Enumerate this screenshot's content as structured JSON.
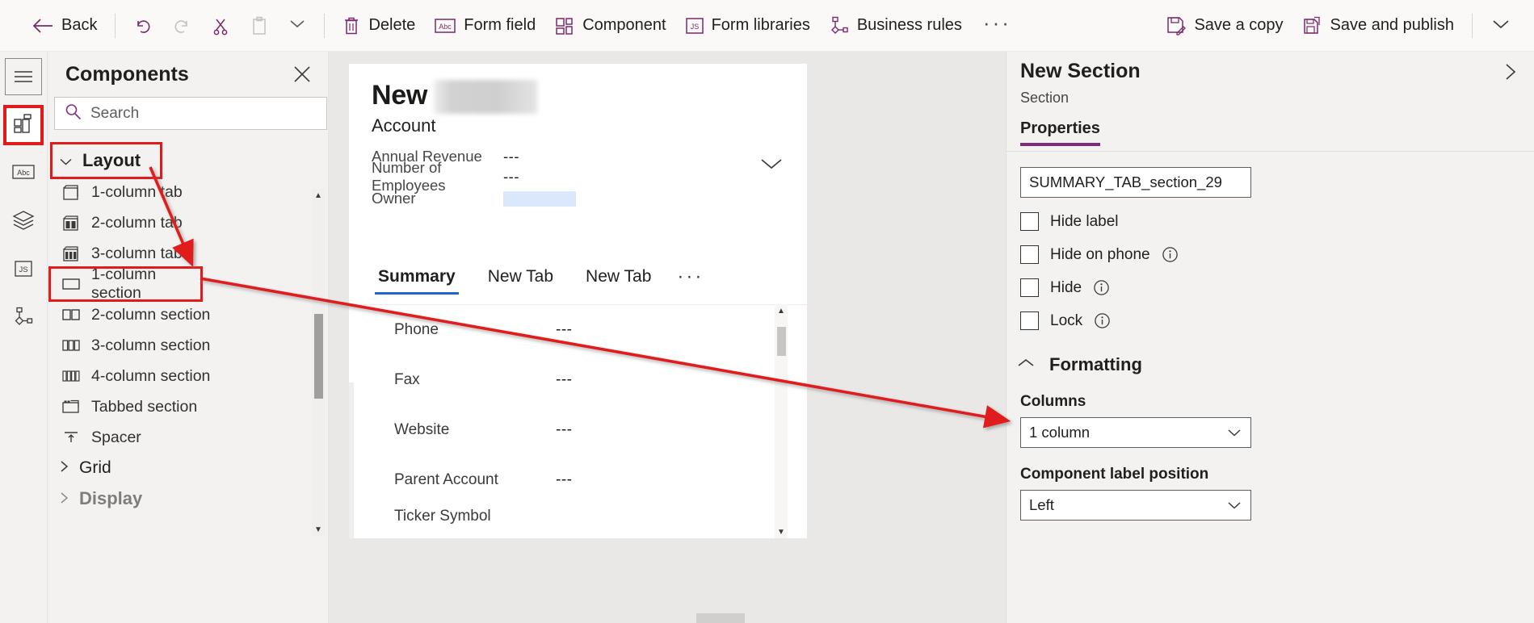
{
  "commandbar": {
    "back_label": "Back",
    "undo_icon": "undo-icon",
    "redo_icon": "redo-icon",
    "cut_icon": "cut-icon",
    "paste_icon": "paste-icon",
    "more_chevron_icon": "chevron-down-icon",
    "delete_label": "Delete",
    "form_field_label": "Form field",
    "component_label": "Component",
    "form_libraries_label": "Form libraries",
    "business_rules_label": "Business rules",
    "overflow_label": "···",
    "save_a_copy_label": "Save a copy",
    "save_and_publish_label": "Save and publish",
    "publish_chevron_icon": "chevron-down-icon"
  },
  "rail": {
    "items": [
      {
        "name": "menu-icon",
        "label": "Menu"
      },
      {
        "name": "components-icon",
        "label": "Components"
      },
      {
        "name": "table-columns-icon",
        "label": "Table columns"
      },
      {
        "name": "layers-icon",
        "label": "Tree view"
      },
      {
        "name": "js-icon",
        "label": "Form libraries"
      },
      {
        "name": "business-rules-icon",
        "label": "Business rules"
      }
    ]
  },
  "components_panel": {
    "title": "Components",
    "close_icon": "close-icon",
    "search": {
      "placeholder": "Search",
      "value": "",
      "icon": "search-icon"
    },
    "groups": [
      {
        "label": "Layout",
        "expanded": true,
        "highlighted": true,
        "items": [
          {
            "label": "1-column tab",
            "icon": "one-column-tab-icon",
            "highlighted": false
          },
          {
            "label": "2-column tab",
            "icon": "two-column-tab-icon",
            "highlighted": false
          },
          {
            "label": "3-column tab",
            "icon": "three-column-tab-icon",
            "highlighted": false
          },
          {
            "label": "1-column section",
            "icon": "one-column-section-icon",
            "highlighted": true
          },
          {
            "label": "2-column section",
            "icon": "two-column-section-icon",
            "highlighted": false
          },
          {
            "label": "3-column section",
            "icon": "three-column-section-icon",
            "highlighted": false
          },
          {
            "label": "4-column section",
            "icon": "four-column-section-icon",
            "highlighted": false
          },
          {
            "label": "Tabbed section",
            "icon": "tabbed-section-icon",
            "highlighted": false
          },
          {
            "label": "Spacer",
            "icon": "spacer-icon",
            "highlighted": false
          }
        ]
      },
      {
        "label": "Grid",
        "expanded": false,
        "highlighted": false,
        "items": []
      },
      {
        "label": "Display",
        "expanded": false,
        "highlighted": false,
        "items": []
      }
    ]
  },
  "canvas": {
    "form_header": {
      "title": "New",
      "redacted_name": "",
      "subtitle": "Account",
      "expand_icon": "chevron-down-icon",
      "fields": [
        {
          "label": "Annual Revenue",
          "value": "---",
          "filled": false
        },
        {
          "label": "Number of Employees",
          "value": "---",
          "filled": false
        },
        {
          "label": "Owner",
          "value": "",
          "filled": true
        }
      ]
    },
    "tabs": [
      {
        "label": "Summary",
        "active": true
      },
      {
        "label": "New Tab",
        "active": false
      },
      {
        "label": "New Tab",
        "active": false
      }
    ],
    "tabs_overflow": "···",
    "fields": [
      {
        "label": "Phone",
        "value": "---"
      },
      {
        "label": "Fax",
        "value": "---"
      },
      {
        "label": "Website",
        "value": "---"
      },
      {
        "label": "Parent Account",
        "value": "---"
      },
      {
        "label": "Ticker Symbol",
        "value": ""
      }
    ]
  },
  "properties": {
    "title": "New Section",
    "subtitle": "Section",
    "collapse_icon": "chevron-right-icon",
    "tabs": [
      {
        "label": "Properties",
        "active": true
      }
    ],
    "name_field": {
      "value": "SUMMARY_TAB_section_29"
    },
    "checkboxes": [
      {
        "label": "Hide label",
        "checked": false,
        "info": false
      },
      {
        "label": "Hide on phone",
        "checked": false,
        "info": true
      },
      {
        "label": "Hide",
        "checked": false,
        "info": true
      },
      {
        "label": "Lock",
        "checked": false,
        "info": true
      }
    ],
    "formatting": {
      "label": "Formatting",
      "expanded": true,
      "columns_label": "Columns",
      "columns_value": "1 column",
      "label_position_label": "Component label position",
      "label_position_value": "Left"
    }
  },
  "annotation": {
    "color": "#e01b1b"
  }
}
